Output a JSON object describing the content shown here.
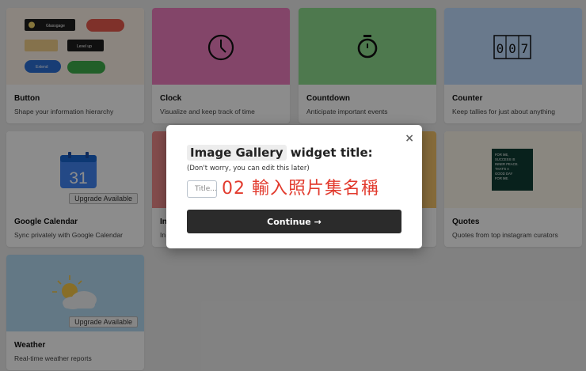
{
  "cards": [
    {
      "id": "button",
      "title": "Button",
      "desc": "Shape your information hierarchy",
      "color": "#fdf3e7"
    },
    {
      "id": "clock",
      "title": "Clock",
      "desc": "Visualize and keep track of time",
      "color": "#ee7fc0"
    },
    {
      "id": "countdown",
      "title": "Countdown",
      "desc": "Anticipate important events",
      "color": "#8fdd8f"
    },
    {
      "id": "counter",
      "title": "Counter",
      "desc": "Keep tallies for just about anything",
      "color": "#bfdcff"
    },
    {
      "id": "google-calendar",
      "title": "Google Calendar",
      "desc": "Sync privately with Google Calendar",
      "upgrade": "Upgrade Available"
    },
    {
      "id": "image-gallery",
      "title": "In",
      "desc": "In"
    },
    {
      "id": "quotes",
      "title": "Quotes",
      "desc": "Quotes from top instagram curators"
    },
    {
      "id": "weather",
      "title": "Weather",
      "desc": "Real-time weather reports",
      "upgrade": "Upgrade Available",
      "color": "#b5dbf2"
    }
  ],
  "button_preview": {
    "labels": [
      "Glassgage",
      "Level up",
      "Extend"
    ]
  },
  "counter_digits": [
    "0",
    "0",
    "7"
  ],
  "calendar_day": "31",
  "quote_lines": [
    "FOR ME,",
    "SUCCESS IS",
    "INNER PEACE.",
    "THAT'S A",
    "GOOD DAY",
    "FOR ME."
  ],
  "modal": {
    "widget_name": "Image Gallery",
    "heading_suffix": "widget title:",
    "subtext": "(Don't worry, you can edit this later)",
    "input_placeholder": "Title...",
    "input_value": "",
    "annotation": "02 輸入照片集名稱",
    "continue_label": "Continue →",
    "close_label": "×"
  },
  "colors": {
    "overlay": "rgba(0,0,0,0.45)",
    "continue_button": "#2b2b2b",
    "annotation": "#e23b2e"
  }
}
